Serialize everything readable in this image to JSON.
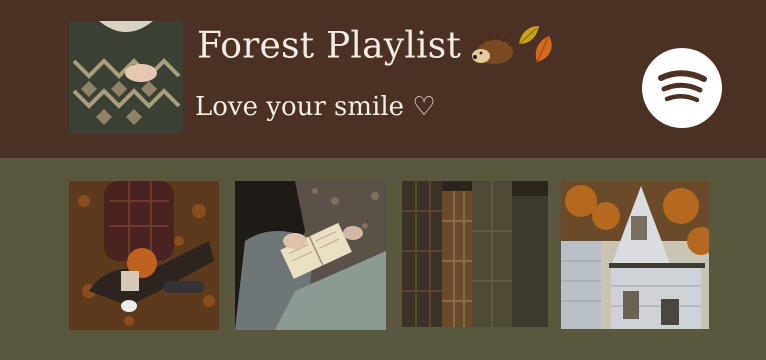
{
  "playlist": {
    "title": "Forest Playlist",
    "subtitle": "Love your smile ♡",
    "title_emoji_icons": [
      "hedgehog-icon",
      "autumn-leaves-icon"
    ]
  },
  "header": {
    "background_color": "#4a3123",
    "text_color": "#f3ece4"
  },
  "page": {
    "background_color": "#5a573f"
  },
  "spotify_button": {
    "icon": "spotify-logo-icon",
    "circle_color": "#ffffff",
    "wave_color": "#4a3123"
  },
  "cover_image": {
    "subject": "knitted-sweater-photo"
  },
  "gallery": [
    {
      "subject": "autumn-leaves-sitting-photo"
    },
    {
      "subject": "reading-book-photo"
    },
    {
      "subject": "plaid-coats-photo"
    },
    {
      "subject": "autumn-house-photo"
    }
  ]
}
